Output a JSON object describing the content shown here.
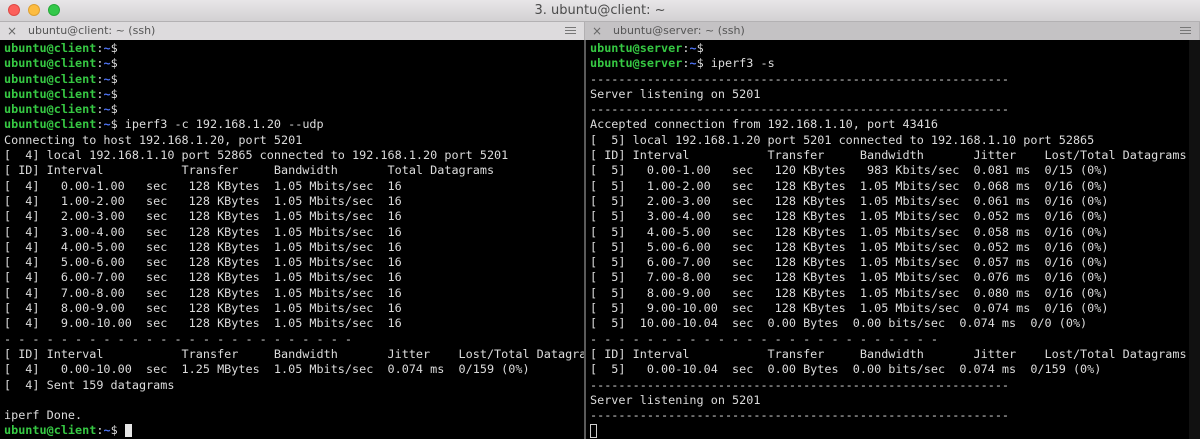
{
  "window": {
    "title": "3. ubuntu@client: ~"
  },
  "tabs": [
    {
      "label": "ubuntu@client: ~ (ssh)"
    },
    {
      "label": "ubuntu@server: ~ (ssh)"
    }
  ],
  "icons": {
    "close": "×"
  },
  "colors": {
    "prompt_user": "#36c843",
    "prompt_path": "#4f74f5",
    "text": "#dcdcdc",
    "background": "#000000"
  },
  "client": {
    "lines": [
      {
        "prompt": "ubuntu@client",
        "path": "~",
        "cmd": ""
      },
      {
        "prompt": "ubuntu@client",
        "path": "~",
        "cmd": ""
      },
      {
        "prompt": "ubuntu@client",
        "path": "~",
        "cmd": ""
      },
      {
        "prompt": "ubuntu@client",
        "path": "~",
        "cmd": ""
      },
      {
        "prompt": "ubuntu@client",
        "path": "~",
        "cmd": ""
      },
      {
        "prompt": "ubuntu@client",
        "path": "~",
        "cmd": " iperf3 -c 192.168.1.20 --udp"
      },
      {
        "text": "Connecting to host 192.168.1.20, port 5201"
      },
      {
        "text": "[  4] local 192.168.1.10 port 52865 connected to 192.168.1.20 port 5201"
      },
      {
        "text": "[ ID] Interval           Transfer     Bandwidth       Total Datagrams"
      },
      {
        "text": "[  4]   0.00-1.00   sec   128 KBytes  1.05 Mbits/sec  16"
      },
      {
        "text": "[  4]   1.00-2.00   sec   128 KBytes  1.05 Mbits/sec  16"
      },
      {
        "text": "[  4]   2.00-3.00   sec   128 KBytes  1.05 Mbits/sec  16"
      },
      {
        "text": "[  4]   3.00-4.00   sec   128 KBytes  1.05 Mbits/sec  16"
      },
      {
        "text": "[  4]   4.00-5.00   sec   128 KBytes  1.05 Mbits/sec  16"
      },
      {
        "text": "[  4]   5.00-6.00   sec   128 KBytes  1.05 Mbits/sec  16"
      },
      {
        "text": "[  4]   6.00-7.00   sec   128 KBytes  1.05 Mbits/sec  16"
      },
      {
        "text": "[  4]   7.00-8.00   sec   128 KBytes  1.05 Mbits/sec  16"
      },
      {
        "text": "[  4]   8.00-9.00   sec   128 KBytes  1.05 Mbits/sec  16"
      },
      {
        "text": "[  4]   9.00-10.00  sec   128 KBytes  1.05 Mbits/sec  16"
      },
      {
        "text": "- - - - - - - - - - - - - - - - - - - - - - - - -"
      },
      {
        "text": "[ ID] Interval           Transfer     Bandwidth       Jitter    Lost/Total Datagrams"
      },
      {
        "text": "[  4]   0.00-10.00  sec  1.25 MBytes  1.05 Mbits/sec  0.074 ms  0/159 (0%)"
      },
      {
        "text": "[  4] Sent 159 datagrams"
      },
      {
        "text": ""
      },
      {
        "text": "iperf Done."
      },
      {
        "prompt": "ubuntu@client",
        "path": "~",
        "cmd": " ",
        "cursor": "block"
      }
    ]
  },
  "server": {
    "lines": [
      {
        "prompt": "ubuntu@server",
        "path": "~",
        "cmd": ""
      },
      {
        "prompt": "ubuntu@server",
        "path": "~",
        "cmd": " iperf3 -s"
      },
      {
        "text": "-----------------------------------------------------------"
      },
      {
        "text": "Server listening on 5201"
      },
      {
        "text": "-----------------------------------------------------------"
      },
      {
        "text": "Accepted connection from 192.168.1.10, port 43416"
      },
      {
        "text": "[  5] local 192.168.1.20 port 5201 connected to 192.168.1.10 port 52865"
      },
      {
        "text": "[ ID] Interval           Transfer     Bandwidth       Jitter    Lost/Total Datagrams"
      },
      {
        "text": "[  5]   0.00-1.00   sec   120 KBytes   983 Kbits/sec  0.081 ms  0/15 (0%)"
      },
      {
        "text": "[  5]   1.00-2.00   sec   128 KBytes  1.05 Mbits/sec  0.068 ms  0/16 (0%)"
      },
      {
        "text": "[  5]   2.00-3.00   sec   128 KBytes  1.05 Mbits/sec  0.061 ms  0/16 (0%)"
      },
      {
        "text": "[  5]   3.00-4.00   sec   128 KBytes  1.05 Mbits/sec  0.052 ms  0/16 (0%)"
      },
      {
        "text": "[  5]   4.00-5.00   sec   128 KBytes  1.05 Mbits/sec  0.058 ms  0/16 (0%)"
      },
      {
        "text": "[  5]   5.00-6.00   sec   128 KBytes  1.05 Mbits/sec  0.052 ms  0/16 (0%)"
      },
      {
        "text": "[  5]   6.00-7.00   sec   128 KBytes  1.05 Mbits/sec  0.057 ms  0/16 (0%)"
      },
      {
        "text": "[  5]   7.00-8.00   sec   128 KBytes  1.05 Mbits/sec  0.076 ms  0/16 (0%)"
      },
      {
        "text": "[  5]   8.00-9.00   sec   128 KBytes  1.05 Mbits/sec  0.080 ms  0/16 (0%)"
      },
      {
        "text": "[  5]   9.00-10.00  sec   128 KBytes  1.05 Mbits/sec  0.074 ms  0/16 (0%)"
      },
      {
        "text": "[  5]  10.00-10.04  sec  0.00 Bytes  0.00 bits/sec  0.074 ms  0/0 (0%)"
      },
      {
        "text": "- - - - - - - - - - - - - - - - - - - - - - - - -"
      },
      {
        "text": "[ ID] Interval           Transfer     Bandwidth       Jitter    Lost/Total Datagrams"
      },
      {
        "text": "[  5]   0.00-10.04  sec  0.00 Bytes  0.00 bits/sec  0.074 ms  0/159 (0%)"
      },
      {
        "text": "-----------------------------------------------------------"
      },
      {
        "text": "Server listening on 5201"
      },
      {
        "text": "-----------------------------------------------------------"
      },
      {
        "text": "",
        "cursor": "hollow"
      }
    ]
  }
}
